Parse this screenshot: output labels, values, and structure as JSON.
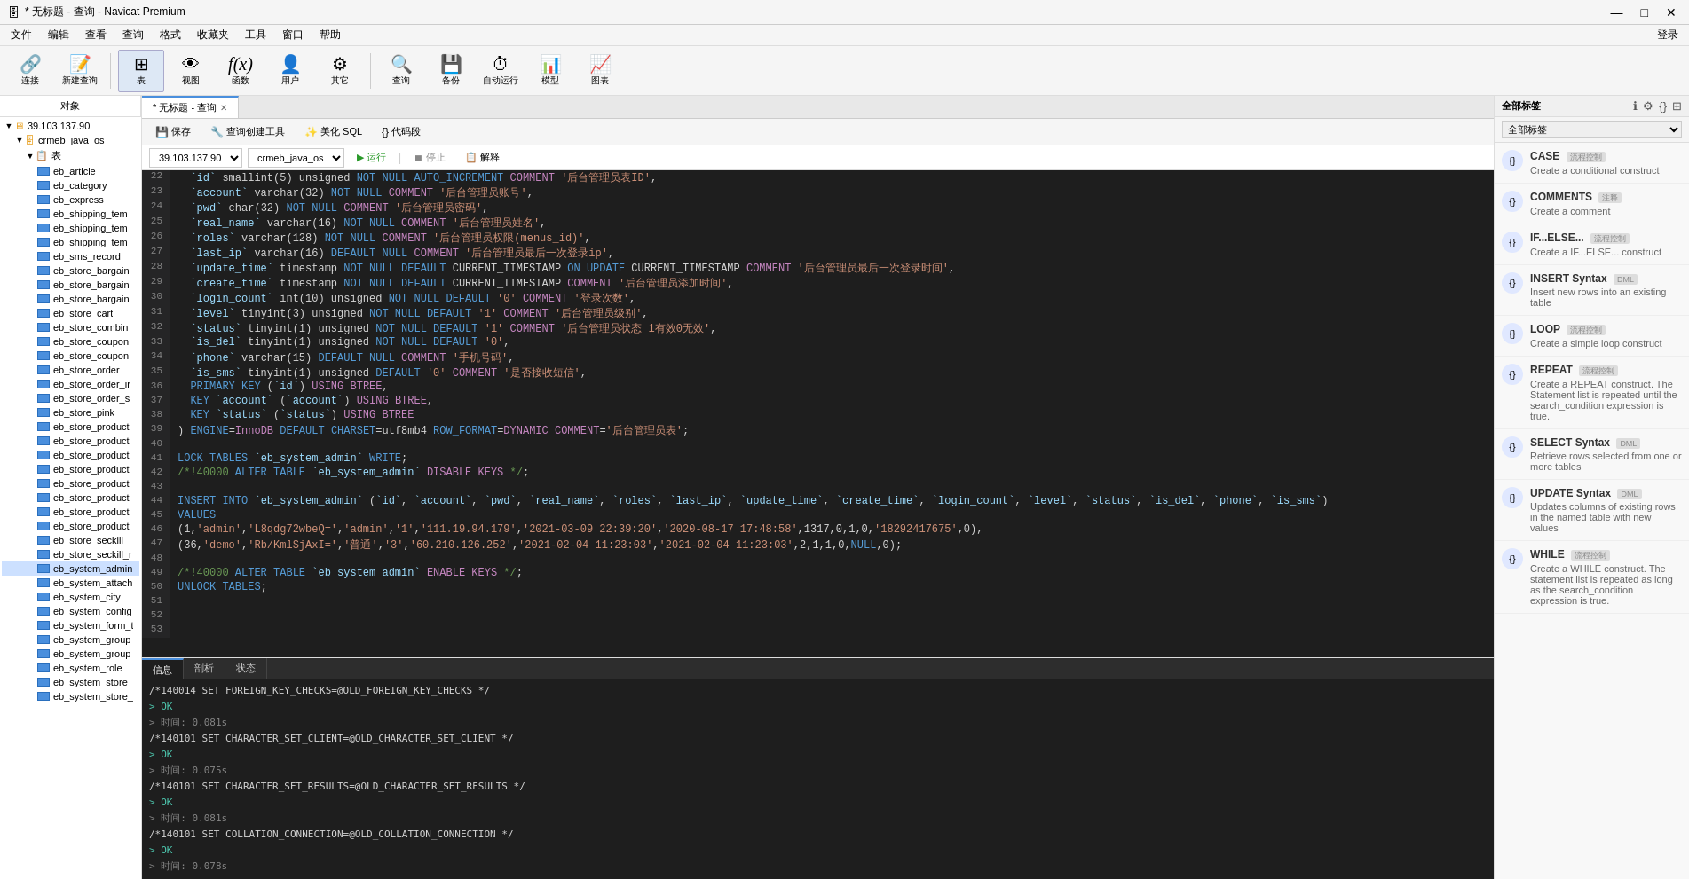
{
  "titleBar": {
    "title": "* 无标题 - 查询 - Navicat Premium",
    "buttons": [
      "—",
      "□",
      "✕"
    ]
  },
  "menuBar": {
    "items": [
      "文件",
      "编辑",
      "查看",
      "查询",
      "格式",
      "收藏夹",
      "工具",
      "窗口",
      "帮助"
    ]
  },
  "toolbar": {
    "items": [
      {
        "label": "连接",
        "icon": "🔗"
      },
      {
        "label": "新建查询",
        "icon": "📄"
      },
      {
        "label": "表",
        "icon": "⊞",
        "active": true
      },
      {
        "label": "视图",
        "icon": "👁"
      },
      {
        "label": "函数",
        "icon": "ƒ"
      },
      {
        "label": "用户",
        "icon": "👤"
      },
      {
        "label": "其它",
        "icon": "⚙"
      },
      {
        "label": "查询",
        "icon": "🔍"
      },
      {
        "label": "备份",
        "icon": "💾"
      },
      {
        "label": "自动运行",
        "icon": "⏱"
      },
      {
        "label": "模型",
        "icon": "📊"
      },
      {
        "label": "图表",
        "icon": "📈"
      }
    ],
    "user": "登录"
  },
  "leftPanel": {
    "tab": "对象",
    "tree": {
      "root": "39.103.137.90",
      "db": "crmeb_java_os",
      "tableGroup": "表",
      "tables": [
        "eb_article",
        "eb_category",
        "eb_express",
        "eb_shipping_tem",
        "eb_shipping_tem",
        "eb_shipping_tem",
        "eb_sms_record",
        "eb_store_bargain",
        "eb_store_bargain",
        "eb_store_bargain",
        "eb_store_cart",
        "eb_store_combin",
        "eb_store_coupon",
        "eb_store_coupon",
        "eb_store_order",
        "eb_store_order_ir",
        "eb_store_order_s",
        "eb_store_pink",
        "eb_store_product",
        "eb_store_product",
        "eb_store_product",
        "eb_store_product",
        "eb_store_product",
        "eb_store_product",
        "eb_store_product",
        "eb_store_product",
        "eb_store_seckill",
        "eb_store_seckill_r",
        "eb_system_admin",
        "eb_system_attach",
        "eb_system_city",
        "eb_system_config",
        "eb_system_form_t",
        "eb_system_group",
        "eb_system_group",
        "eb_system_role",
        "eb_system_store",
        "eb_system_store_"
      ]
    }
  },
  "tabs": [
    {
      "label": "* 无标题 - 查询",
      "active": true
    }
  ],
  "queryToolbar": {
    "save": "保存",
    "queryCreator": "查询创建工具",
    "beautify": "美化 SQL",
    "codeSnippet": "代码段"
  },
  "connBar": {
    "server": "39.103.137.90",
    "database": "crmeb_java_os",
    "run": "运行",
    "stop": "停止",
    "explain": "解释"
  },
  "sqlLines": [
    {
      "num": "22",
      "content": "  `id` smallint(5) unsigned NOT NULL AUTO_INCREMENT COMMENT '后台管理员表ID',"
    },
    {
      "num": "23",
      "content": "  `account` varchar(32) NOT NULL COMMENT '后台管理员账号',"
    },
    {
      "num": "24",
      "content": "  `pwd` char(32) NOT NULL COMMENT '后台管理员密码',"
    },
    {
      "num": "25",
      "content": "  `real_name` varchar(16) NOT NULL COMMENT '后台管理员姓名',"
    },
    {
      "num": "26",
      "content": "  `roles` varchar(128) NOT NULL COMMENT '后台管理员权限(menus_id)',"
    },
    {
      "num": "27",
      "content": "  `last_ip` varchar(16) DEFAULT NULL COMMENT '后台管理员最后一次登录ip',"
    },
    {
      "num": "28",
      "content": "  `update_time` timestamp NOT NULL DEFAULT CURRENT_TIMESTAMP ON UPDATE CURRENT_TIMESTAMP COMMENT '后台管理员最后一次登录时间',"
    },
    {
      "num": "29",
      "content": "  `create_time` timestamp NOT NULL DEFAULT CURRENT_TIMESTAMP COMMENT '后台管理员添加时间',"
    },
    {
      "num": "30",
      "content": "  `login_count` int(10) unsigned NOT NULL DEFAULT '0' COMMENT '登录次数',"
    },
    {
      "num": "31",
      "content": "  `level` tinyint(3) unsigned NOT NULL DEFAULT '1' COMMENT '后台管理员级别',"
    },
    {
      "num": "32",
      "content": "  `status` tinyint(1) unsigned NOT NULL DEFAULT '1' COMMENT '后台管理员状态 1有效0无效',"
    },
    {
      "num": "33",
      "content": "  `is_del` tinyint(1) unsigned NOT NULL DEFAULT '0',"
    },
    {
      "num": "34",
      "content": "  `phone` varchar(15) DEFAULT NULL COMMENT '手机号码',"
    },
    {
      "num": "35",
      "content": "  `is_sms` tinyint(1) unsigned DEFAULT '0' COMMENT '是否接收短信',"
    },
    {
      "num": "36",
      "content": "  PRIMARY KEY (`id`) USING BTREE,"
    },
    {
      "num": "37",
      "content": "  KEY `account` (`account`) USING BTREE,"
    },
    {
      "num": "38",
      "content": "  KEY `status` (`status`) USING BTREE"
    },
    {
      "num": "39",
      "content": ") ENGINE=InnoDB DEFAULT CHARSET=utf8mb4 ROW_FORMAT=DYNAMIC COMMENT='后台管理员表';"
    },
    {
      "num": "40",
      "content": ""
    },
    {
      "num": "41",
      "content": "LOCK TABLES `eb_system_admin` WRITE;"
    },
    {
      "num": "42",
      "content": "/*!40000 ALTER TABLE `eb_system_admin` DISABLE KEYS */;"
    },
    {
      "num": "43",
      "content": ""
    },
    {
      "num": "44",
      "content": "INSERT INTO `eb_system_admin` (`id`, `account`, `pwd`, `real_name`, `roles`, `last_ip`, `update_time`, `create_time`, `login_count`, `level`, `status`, `is_del`, `phone`, `is_sms`)"
    },
    {
      "num": "45",
      "content": "VALUES"
    },
    {
      "num": "46",
      "content": "(1,'admin','L8qdg72wbeQ=','admin','1','111.19.94.179','2021-03-09 22:39:20','2020-08-17 17:48:58',1317,0,1,0,'18292417675',0),"
    },
    {
      "num": "47",
      "content": "(36,'demo','Rb/KmlSjAxI=','普通','3','60.210.126.252','2021-02-04 11:23:03','2021-02-04 11:23:03',2,1,1,0,NULL,0);"
    },
    {
      "num": "48",
      "content": ""
    },
    {
      "num": "49",
      "content": "/*!40000 ALTER TABLE `eb_system_admin` ENABLE KEYS */;"
    },
    {
      "num": "50",
      "content": "UNLOCK TABLES;"
    },
    {
      "num": "51",
      "content": ""
    },
    {
      "num": "52",
      "content": ""
    },
    {
      "num": "53",
      "content": ""
    }
  ],
  "bottomTabs": [
    "信息",
    "剖析",
    "状态"
  ],
  "activeBottomTab": "信息",
  "logLines": [
    {
      "text": "/*140014 SET FOREIGN_KEY_CHECKS=@OLD_FOREIGN_KEY_CHECKS */"
    },
    {
      "text": "> OK",
      "type": "ok"
    },
    {
      "text": "> 时间: 0.081s",
      "type": "time"
    },
    {
      "text": ""
    },
    {
      "text": "/*140101 SET CHARACTER_SET_CLIENT=@OLD_CHARACTER_SET_CLIENT */"
    },
    {
      "text": "> OK",
      "type": "ok"
    },
    {
      "text": "> 时间: 0.075s",
      "type": "time"
    },
    {
      "text": ""
    },
    {
      "text": "/*140101 SET CHARACTER_SET_RESULTS=@OLD_CHARACTER_SET_RESULTS */"
    },
    {
      "text": "> OK",
      "type": "ok"
    },
    {
      "text": "> 时间: 0.081s",
      "type": "time"
    },
    {
      "text": ""
    },
    {
      "text": "/*140101 SET COLLATION_CONNECTION=@OLD_COLLATION_CONNECTION */"
    },
    {
      "text": "> OK",
      "type": "ok"
    },
    {
      "text": "> 时间: 0.078s",
      "type": "time"
    }
  ],
  "rightPanel": {
    "title": "全部标签",
    "dropdownLabel": "全部标签",
    "snippets": [
      {
        "name": "CASE",
        "badge": "流程控制",
        "desc": "Create a conditional construct",
        "icon": "{}"
      },
      {
        "name": "COMMENTS",
        "badge": "注释",
        "desc": "Create a comment",
        "icon": "{}"
      },
      {
        "name": "IF...ELSE...",
        "badge": "流程控制",
        "desc": "Create a IF...ELSE... construct",
        "icon": "{}"
      },
      {
        "name": "INSERT Syntax",
        "badge": "DML",
        "desc": "Insert new rows into an existing table",
        "icon": "{}"
      },
      {
        "name": "LOOP",
        "badge": "流程控制",
        "desc": "Create a simple loop construct",
        "icon": "{}"
      },
      {
        "name": "REPEAT",
        "badge": "流程控制",
        "desc": "Create a REPEAT construct. The Statement list is repeated until the search_condition expression is true.",
        "icon": "{}"
      },
      {
        "name": "SELECT Syntax",
        "badge": "DML",
        "desc": "Retrieve rows selected from one or more tables",
        "icon": "{}"
      },
      {
        "name": "UPDATE Syntax",
        "badge": "DML",
        "desc": "Updates columns of existing rows in the named table with new values",
        "icon": "{}"
      },
      {
        "name": "WHILE",
        "badge": "流程控制",
        "desc": "Create a WHILE construct. The statement list is repeated as long as the search_condition expression is true.",
        "icon": "{}"
      }
    ]
  }
}
